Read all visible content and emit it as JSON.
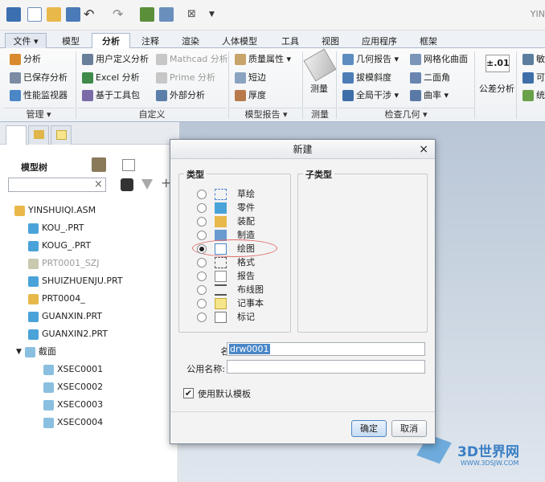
{
  "app_title": "YIN",
  "quick_access": {
    "icons": [
      "window-icon",
      "new-file-icon",
      "open-folder-icon",
      "save-icon",
      "undo-icon",
      "redo-icon",
      "regenerate-icon",
      "windows-icon",
      "close-window-icon",
      "customize-icon"
    ]
  },
  "tabs": [
    "文件 ▾",
    "模型",
    "分析",
    "注释",
    "渲染",
    "人体模型",
    "工具",
    "视图",
    "应用程序",
    "框架"
  ],
  "ribbon": {
    "manage": {
      "items": [
        "分析",
        "已保存分析",
        "性能监视器"
      ],
      "label": "管理 ▾"
    },
    "custom": {
      "items": [
        "用户定义分析",
        "Excel 分析",
        "基于工具包",
        "Mathcad 分析",
        "Prime 分析",
        "外部分析"
      ],
      "label": "自定义"
    },
    "model_report": {
      "items": [
        "质量属性 ▾",
        "短边",
        "厚度"
      ],
      "label": "模型报告 ▾"
    },
    "measure": {
      "button": "测量",
      "label": "测量"
    },
    "inspect": {
      "items": [
        "几何报告 ▾",
        "拔模斜度",
        "全局干涉 ▾",
        "网格化曲面",
        "二面角",
        "曲率 ▾"
      ],
      "label": "检查几何 ▾"
    },
    "tolerance": {
      "badge": "±.01",
      "label": "公差分析"
    },
    "cut": [
      "敏",
      "可",
      "统"
    ]
  },
  "left_panel": {
    "title": "模型树",
    "search_clear": "×",
    "tree": [
      {
        "label": "YINSHUIQI.ASM",
        "gray": false
      },
      {
        "label": "KOU_.PRT",
        "gray": false
      },
      {
        "label": "KOUG_.PRT",
        "gray": false
      },
      {
        "label": "PRT0001_SZJ",
        "gray": true
      },
      {
        "label": "SHUIZHUENJU.PRT",
        "gray": false
      },
      {
        "label": "PRT0004_",
        "gray": false
      },
      {
        "label": "GUANXIN.PRT",
        "gray": false
      },
      {
        "label": "GUANXIN2.PRT",
        "gray": false
      },
      {
        "label": "截面",
        "gray": false
      },
      {
        "label": "XSEC0001",
        "gray": false
      },
      {
        "label": "XSEC0002",
        "gray": false
      },
      {
        "label": "XSEC0003",
        "gray": false
      },
      {
        "label": "XSEC0004",
        "gray": false
      }
    ]
  },
  "dialog": {
    "title": "新建",
    "close": "×",
    "type_legend": "类型",
    "subtype_legend": "子类型",
    "types": [
      "草绘",
      "零件",
      "装配",
      "制造",
      "绘图",
      "格式",
      "报告",
      "布线图",
      "记事本",
      "标记"
    ],
    "selected_type": "绘图",
    "name_label": "名称:",
    "name_value": "drw0001",
    "common_name_label": "公用名称:",
    "common_name_value": "",
    "use_default_template": "使用默认模板",
    "use_default_checked": true,
    "ok": "确定",
    "cancel": "取消"
  },
  "watermark": {
    "logo": "3D世界网",
    "url": "WWW.3DSJW.COM"
  },
  "colors": {
    "accent": "#4a87c8",
    "highlight_ring": "#e06a6a",
    "active_tab_border": "#a9b8cc"
  }
}
